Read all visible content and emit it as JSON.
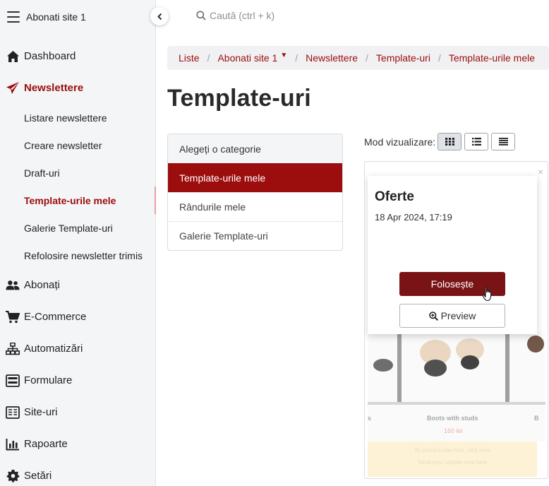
{
  "sidebar": {
    "account_title": "Abonati site 1",
    "main_items": [
      {
        "label": "Dashboard",
        "icon": "home-icon"
      },
      {
        "label": "Newslettere",
        "icon": "paper-plane-icon"
      },
      {
        "label": "Abonați",
        "icon": "users-icon"
      },
      {
        "label": "E-Commerce",
        "icon": "cart-icon"
      },
      {
        "label": "Automatizări",
        "icon": "sitemap-icon"
      },
      {
        "label": "Formulare",
        "icon": "form-icon"
      },
      {
        "label": "Site-uri",
        "icon": "website-icon"
      },
      {
        "label": "Rapoarte",
        "icon": "bar-chart-icon"
      },
      {
        "label": "Setări",
        "icon": "gear-icon"
      }
    ],
    "sub_items": [
      {
        "label": "Listare newslettere"
      },
      {
        "label": "Creare newsletter"
      },
      {
        "label": "Draft-uri"
      },
      {
        "label": "Template-urile mele"
      },
      {
        "label": "Galerie Template-uri"
      },
      {
        "label": "Refolosire newsletter trimis"
      }
    ]
  },
  "search": {
    "placeholder": "Caută (ctrl + k)"
  },
  "breadcrumb": [
    "Liste",
    "Abonati site 1",
    "Newslettere",
    "Template-uri",
    "Template-urile mele"
  ],
  "page": {
    "title": "Template-uri"
  },
  "categories": {
    "header": "Alegeți o categorie",
    "items": [
      "Template-urile mele",
      "Rândurile mele",
      "Galerie Template-uri"
    ]
  },
  "view_mode": {
    "label": "Mod vizualizare:",
    "options": [
      "grid",
      "list",
      "compact"
    ],
    "selected": "grid"
  },
  "template_card": {
    "name": "Oferte",
    "date": "18 Apr 2024, 17:19",
    "use_label": "Folosește",
    "preview_label": "Preview",
    "close_glyph": "×",
    "thumbnail": {
      "caption_left": "s",
      "caption_main": "Boots with studs",
      "caption_right": "B",
      "price": "160 lei",
      "banner_line1": "To unsubscribe now, click here",
      "banner_line2": "Send your update now here"
    }
  },
  "colors": {
    "brand": "#9c0d0d",
    "use_button": "#7a1315",
    "sidebar_bg": "#f4f5f7"
  }
}
